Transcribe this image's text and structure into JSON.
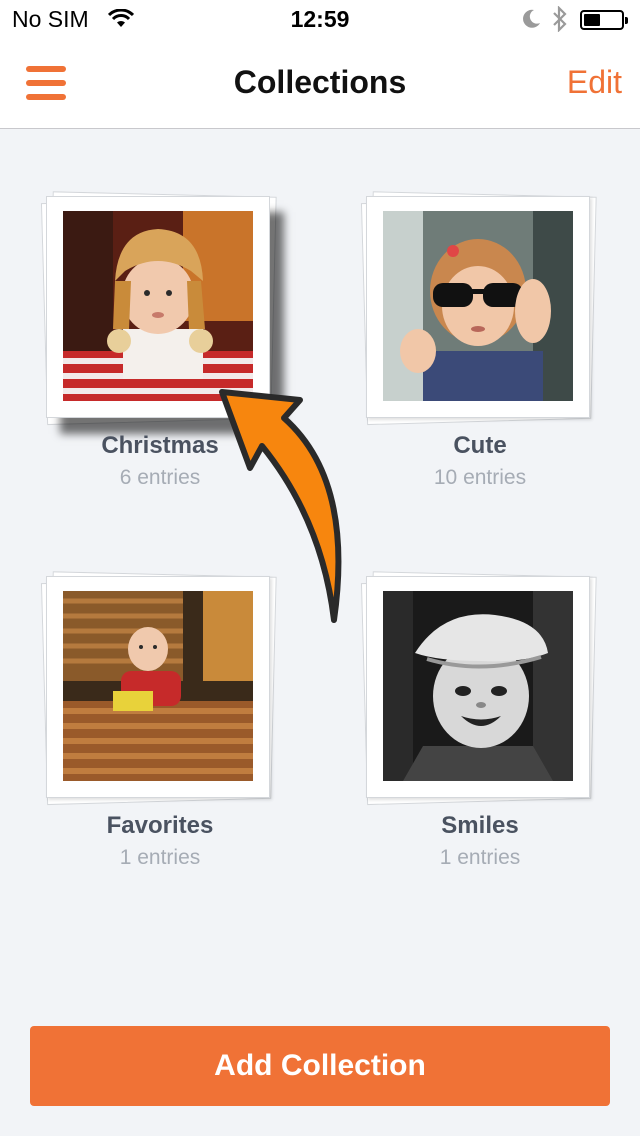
{
  "status_bar": {
    "carrier": "No SIM",
    "time": "12:59"
  },
  "nav": {
    "title": "Collections",
    "edit_label": "Edit",
    "menu_icon": "hamburger-menu-icon"
  },
  "collections": [
    {
      "name": "Christmas",
      "count": "6 entries"
    },
    {
      "name": "Cute",
      "count": "10 entries"
    },
    {
      "name": "Favorites",
      "count": "1 entries"
    },
    {
      "name": "Smiles",
      "count": "1 entries"
    }
  ],
  "add_button": {
    "label": "Add Collection"
  },
  "colors": {
    "accent": "#f07236",
    "background": "#f2f4f7",
    "title_text": "#4a5260",
    "subtitle_text": "#a6acb5"
  },
  "overlay": {
    "annotation_icon": "curved-arrow-icon",
    "color": "#f7860e"
  }
}
